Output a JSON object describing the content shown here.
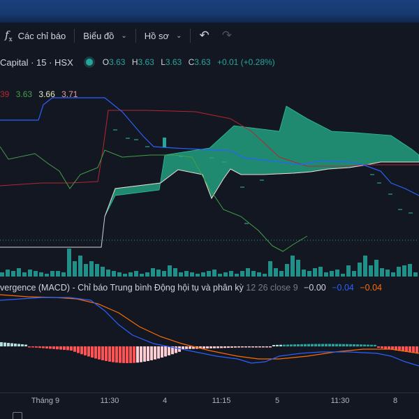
{
  "toolbar": {
    "fx_label": "f",
    "fx_sub": "x",
    "indicators_label": "Các chỉ báo",
    "chart_type_label": "Biểu đồ",
    "profile_label": "Hồ sơ",
    "undo_icon": "undo-icon",
    "redo_icon": "redo-icon"
  },
  "legend": {
    "symbol": "Capital · 15 · HSX",
    "open_key": "O",
    "open": "3.63",
    "high_key": "H",
    "high": "3.63",
    "low_key": "L",
    "low": "3.63",
    "close_key": "C",
    "close": "3.63",
    "change": "+0.01 (+0.28%)"
  },
  "ichimoku": {
    "v1": "39",
    "v2": "3.63",
    "v3": "3.66",
    "v4": "3.71"
  },
  "macd_legend": {
    "name": "vergence (MACD) - Chỉ báo Trung bình Động hội tụ và phân kỳ",
    "params": "12 26 close 9",
    "hist": "−0.00",
    "macd": "−0.04",
    "signal": "−0.04"
  },
  "xaxis": {
    "labels": [
      "Tháng 9",
      "11:30",
      "4",
      "11:15",
      "5",
      "11:30",
      "8"
    ]
  },
  "colors": {
    "background": "#131722",
    "cloud": "#1f8a70",
    "tenkan": "#2962ff",
    "kijun": "#b22833",
    "chikou": "#43a047",
    "macd_line": "#2962ff",
    "signal_line": "#ff6d00",
    "hist_pos": "#b2dfdb",
    "hist_pos_strong": "#26a69a",
    "hist_neg": "#ff5252",
    "hist_neg_light": "#ffcdd2",
    "volume": "#26a69a"
  }
}
